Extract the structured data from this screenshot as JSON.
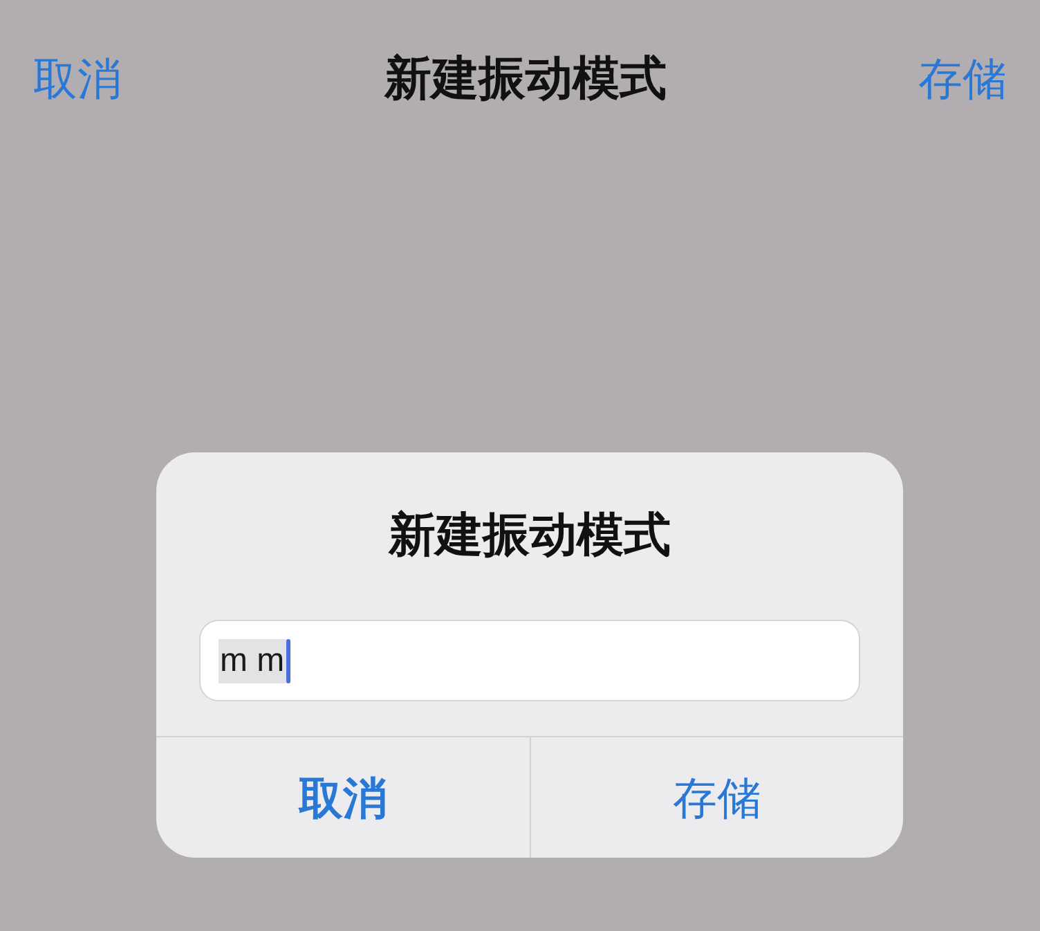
{
  "nav_bar": {
    "cancel": "取消",
    "title": "新建振动模式",
    "save": "存储"
  },
  "dialog": {
    "title": "新建振动模式",
    "text_field": {
      "value": "m m",
      "marked": true,
      "focused": true
    },
    "buttons": [
      {
        "label": "取消",
        "kind": "cancel"
      },
      {
        "label": "存储",
        "kind": "default"
      }
    ]
  }
}
